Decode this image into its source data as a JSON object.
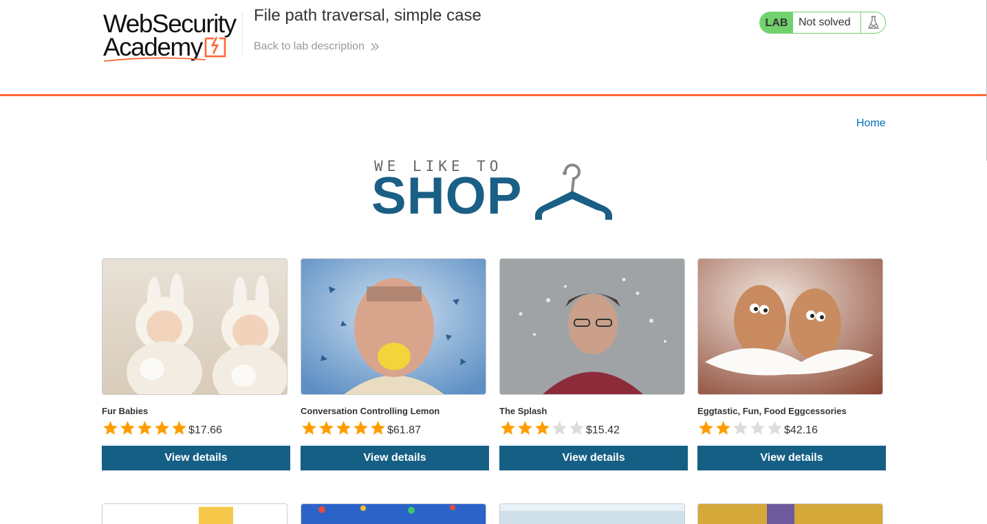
{
  "header": {
    "logo_line1": "WebSecurity",
    "logo_line2": "Academy",
    "lab_title": "File path traversal, simple case",
    "back_link": "Back to lab description",
    "status_badge": "LAB",
    "status_text": "Not solved"
  },
  "nav": {
    "home": "Home"
  },
  "banner": {
    "tagline": "WE LIKE TO",
    "headline": "SHOP"
  },
  "colors": {
    "accent": "#ff6633",
    "lab_green": "#70d16d",
    "button": "#155f85",
    "link": "#0071bc",
    "star_on": "#ff9d00",
    "star_off": "#dcdcdc"
  },
  "products": [
    {
      "name": "Fur Babies",
      "rating": 5,
      "price": "$17.66",
      "button": "View details"
    },
    {
      "name": "Conversation Controlling Lemon",
      "rating": 5,
      "price": "$61.87",
      "button": "View details"
    },
    {
      "name": "The Splash",
      "rating": 3,
      "price": "$15.42",
      "button": "View details"
    },
    {
      "name": "Eggtastic, Fun, Food Eggcessories",
      "rating": 2,
      "price": "$42.16",
      "button": "View details"
    }
  ]
}
